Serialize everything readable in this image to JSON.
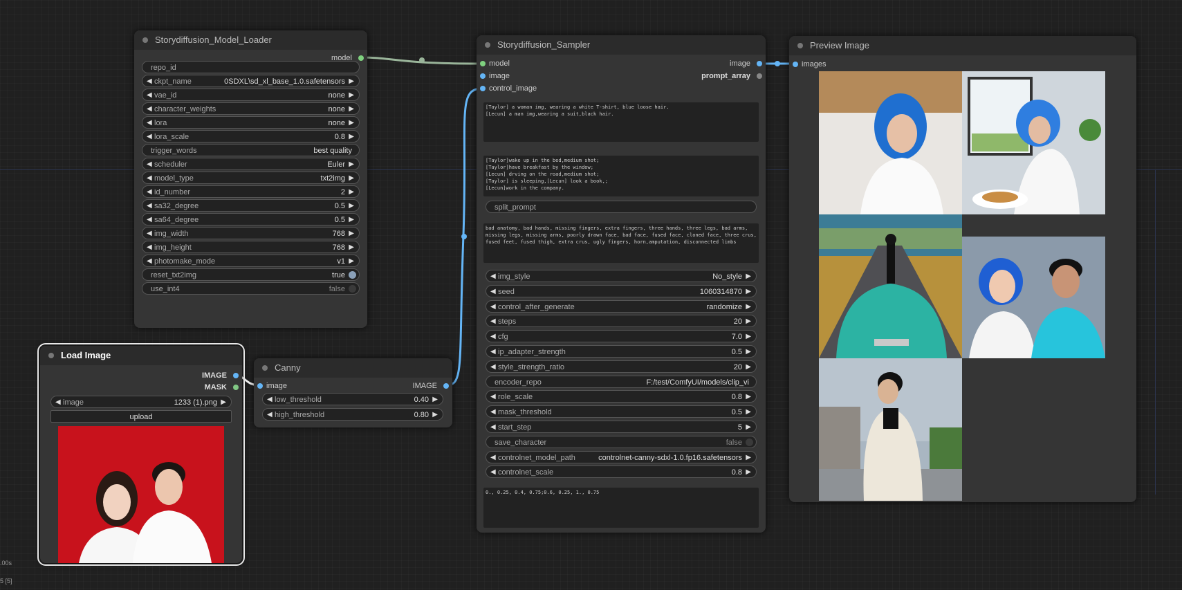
{
  "colors": {
    "model_slot": "#7fd17f",
    "image_slot": "#64b5f6",
    "mask_slot": "#81c784",
    "grey_slot": "#888888",
    "node_bg": "#353535",
    "title_bg": "#2b2b2b",
    "widget_bg": "#222222",
    "canvas_bg": "#202020"
  },
  "model_loader": {
    "title": "Storydiffusion_Model_Loader",
    "outputs": [
      "model"
    ],
    "widgets": [
      {
        "label": "repo_id",
        "value": "",
        "kind": "text"
      },
      {
        "label": "ckpt_name",
        "value": "0SDXL\\sd_xl_base_1.0.safetensors",
        "kind": "combo"
      },
      {
        "label": "vae_id",
        "value": "none",
        "kind": "combo"
      },
      {
        "label": "character_weights",
        "value": "none",
        "kind": "combo"
      },
      {
        "label": "lora",
        "value": "none",
        "kind": "combo"
      },
      {
        "label": "lora_scale",
        "value": "0.8",
        "kind": "number"
      },
      {
        "label": "trigger_words",
        "value": "best quality",
        "kind": "text"
      },
      {
        "label": "scheduler",
        "value": "Euler",
        "kind": "combo"
      },
      {
        "label": "model_type",
        "value": "txt2img",
        "kind": "combo"
      },
      {
        "label": "id_number",
        "value": "2",
        "kind": "number"
      },
      {
        "label": "sa32_degree",
        "value": "0.5",
        "kind": "number"
      },
      {
        "label": "sa64_degree",
        "value": "0.5",
        "kind": "number"
      },
      {
        "label": "img_width",
        "value": "768",
        "kind": "number"
      },
      {
        "label": "img_height",
        "value": "768",
        "kind": "number"
      },
      {
        "label": "photomake_mode",
        "value": "v1",
        "kind": "combo"
      },
      {
        "label": "reset_txt2img",
        "value": "true",
        "kind": "toggle_on"
      },
      {
        "label": "use_int4",
        "value": "false",
        "kind": "toggle_off"
      }
    ]
  },
  "sampler": {
    "title": "Storydiffusion_Sampler",
    "inputs": [
      "model",
      "image",
      "control_image"
    ],
    "outputs": [
      "image",
      "prompt_array"
    ],
    "character_prompt": "[Taylor] a woman img, wearing a white T-shirt, blue loose hair.\n[Lecun] a man img,wearing a suit,black hair.",
    "scene_prompt": "[Taylor]wake up in the bed,medium shot;\n[Taylor]have breakfast by the window;\n[Lecun] drving on the road,medium shot;\n[Taylor] is sleeping,[Lecun] look a book,;\n[Lecun]work in the company.",
    "split_prompt": "split_prompt",
    "negative_prompt": "bad anatomy, bad hands, missing fingers, extra fingers, three hands, three legs, bad arms, missing legs, missing arms, poorly drawn face, bad face, fused face, cloned face, three crus, fused feet, fused thigh, extra crus, ugly fingers, horn,amputation, disconnected limbs",
    "widgets": [
      {
        "label": "img_style",
        "value": "No_style",
        "kind": "combo"
      },
      {
        "label": "seed",
        "value": "1060314870",
        "kind": "number"
      },
      {
        "label": "control_after_generate",
        "value": "randomize",
        "kind": "combo"
      },
      {
        "label": "steps",
        "value": "20",
        "kind": "number"
      },
      {
        "label": "cfg",
        "value": "7.0",
        "kind": "number"
      },
      {
        "label": "ip_adapter_strength",
        "value": "0.5",
        "kind": "number"
      },
      {
        "label": "style_strength_ratio",
        "value": "20",
        "kind": "number"
      },
      {
        "label": "encoder_repo",
        "value": "F:/test/ComfyUI/models/clip_vi",
        "kind": "text"
      },
      {
        "label": "role_scale",
        "value": "0.8",
        "kind": "number"
      },
      {
        "label": "mask_threshold",
        "value": "0.5",
        "kind": "number"
      },
      {
        "label": "start_step",
        "value": "5",
        "kind": "number"
      },
      {
        "label": "save_character",
        "value": "false",
        "kind": "toggle_off"
      },
      {
        "label": "controlnet_model_path",
        "value": "controlnet-canny-sdxl-1.0.fp16.safetensors",
        "kind": "combo"
      },
      {
        "label": "controlnet_scale",
        "value": "0.8",
        "kind": "number"
      }
    ],
    "controlnet_strengths": "0., 0.25, 0.4, 0.75;0.6, 0.25, 1., 0.75"
  },
  "preview": {
    "title": "Preview Image",
    "inputs": [
      "images"
    ],
    "icons": [
      "woman-in-bed-image",
      "woman-at-window-image",
      "man-driving-car-image",
      "couple-portrait-image",
      "man-in-coat-image"
    ]
  },
  "load_image": {
    "title": "Load Image",
    "outputs": [
      "IMAGE",
      "MASK"
    ],
    "image_label": "image",
    "image_value": "1233 (1).png",
    "upload_label": "upload",
    "thumb_icon": "couple-photo-thumbnail"
  },
  "canny": {
    "title": "Canny",
    "inputs": [
      "image"
    ],
    "outputs": [
      "IMAGE"
    ],
    "widgets": [
      {
        "label": "low_threshold",
        "value": "0.40",
        "kind": "number"
      },
      {
        "label": "high_threshold",
        "value": "0.80",
        "kind": "number"
      }
    ]
  },
  "sidebar_text": {
    "line1": ".00s",
    "line2": "5 [5]"
  }
}
